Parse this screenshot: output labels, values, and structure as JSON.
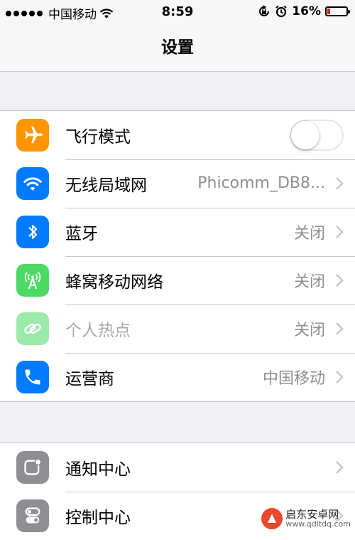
{
  "status_bar": {
    "carrier": "中国移动",
    "time": "8:59",
    "battery_percent": "16%",
    "battery_level": 0.16,
    "signal_bars": 5
  },
  "nav": {
    "title": "设置"
  },
  "groups": [
    {
      "rows": [
        {
          "label": "飞行模式",
          "icon": "airplane-icon",
          "color": "#ff9500",
          "accessory": "toggle",
          "toggle_on": false
        },
        {
          "label": "无线局域网",
          "value": "Phicomm_DB8...",
          "icon": "wifi-icon",
          "color": "#007aff"
        },
        {
          "label": "蓝牙",
          "value": "关闭",
          "icon": "bluetooth-icon",
          "color": "#007aff"
        },
        {
          "label": "蜂窝移动网络",
          "value": "关闭",
          "icon": "cellular-icon",
          "color": "#4cd964"
        },
        {
          "label": "个人热点",
          "value": "关闭",
          "icon": "hotspot-icon",
          "color": "#4cd964",
          "disabled": true
        },
        {
          "label": "运营商",
          "value": "中国移动",
          "icon": "phone-icon",
          "color": "#007aff"
        }
      ]
    },
    {
      "rows": [
        {
          "label": "通知中心",
          "icon": "notification-center-icon",
          "color": "#8e8e93"
        },
        {
          "label": "控制中心",
          "icon": "control-center-icon",
          "color": "#8e8e93"
        }
      ]
    }
  ],
  "watermark": {
    "brand": "启东安卓网",
    "url": "www.qdltdq.com"
  }
}
